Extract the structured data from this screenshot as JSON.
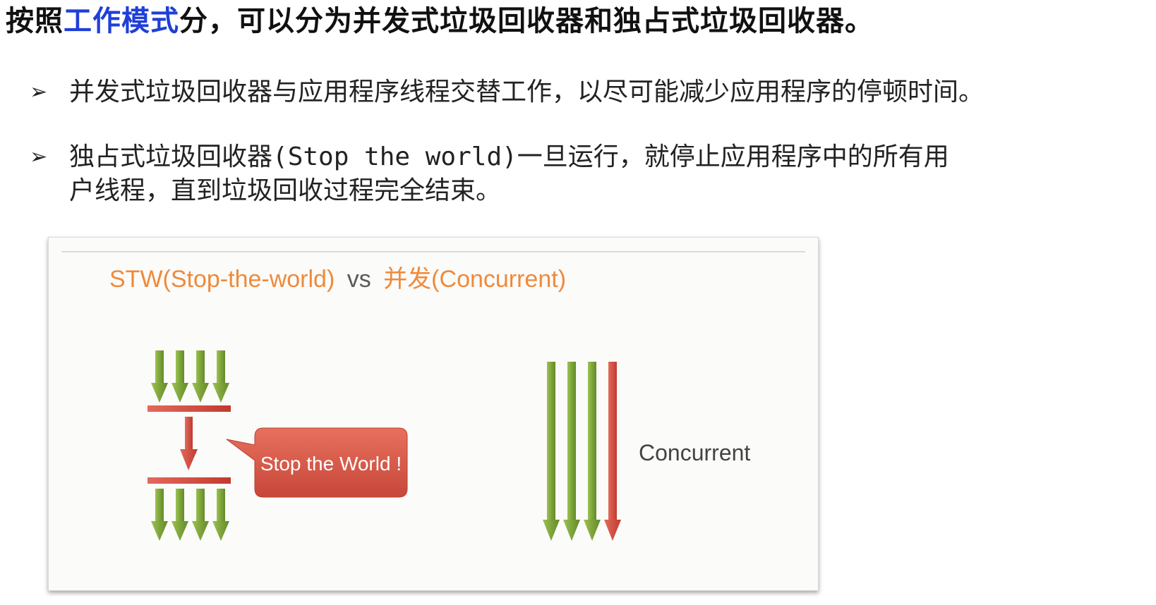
{
  "heading": {
    "prefix": "按照",
    "highlight": "工作模式",
    "suffix": "分，可以分为并发式垃圾回收器和独占式垃圾回收器。"
  },
  "bullets": [
    {
      "marker": "➢",
      "text": "并发式垃圾回收器与应用程序线程交替工作，以尽可能减少应用程序的停顿时间。"
    },
    {
      "marker": "➢",
      "text_a": "独占式垃圾回收器",
      "text_code": "(Stop the world)",
      "text_b": "一旦运行，就停止应用程序中的所有用",
      "line2": "户线程，直到垃圾回收过程完全结束。"
    }
  ],
  "figure": {
    "title_stw": "STW(Stop-the-world)",
    "title_vs": "vs",
    "title_concurrent": "并发(Concurrent)",
    "callout_text": "Stop the World !",
    "concurrent_label": "Concurrent",
    "colors": {
      "green": "#7ea53b",
      "red": "#d2483c",
      "orange": "#ef8a3a",
      "callout": "#d45845"
    }
  }
}
